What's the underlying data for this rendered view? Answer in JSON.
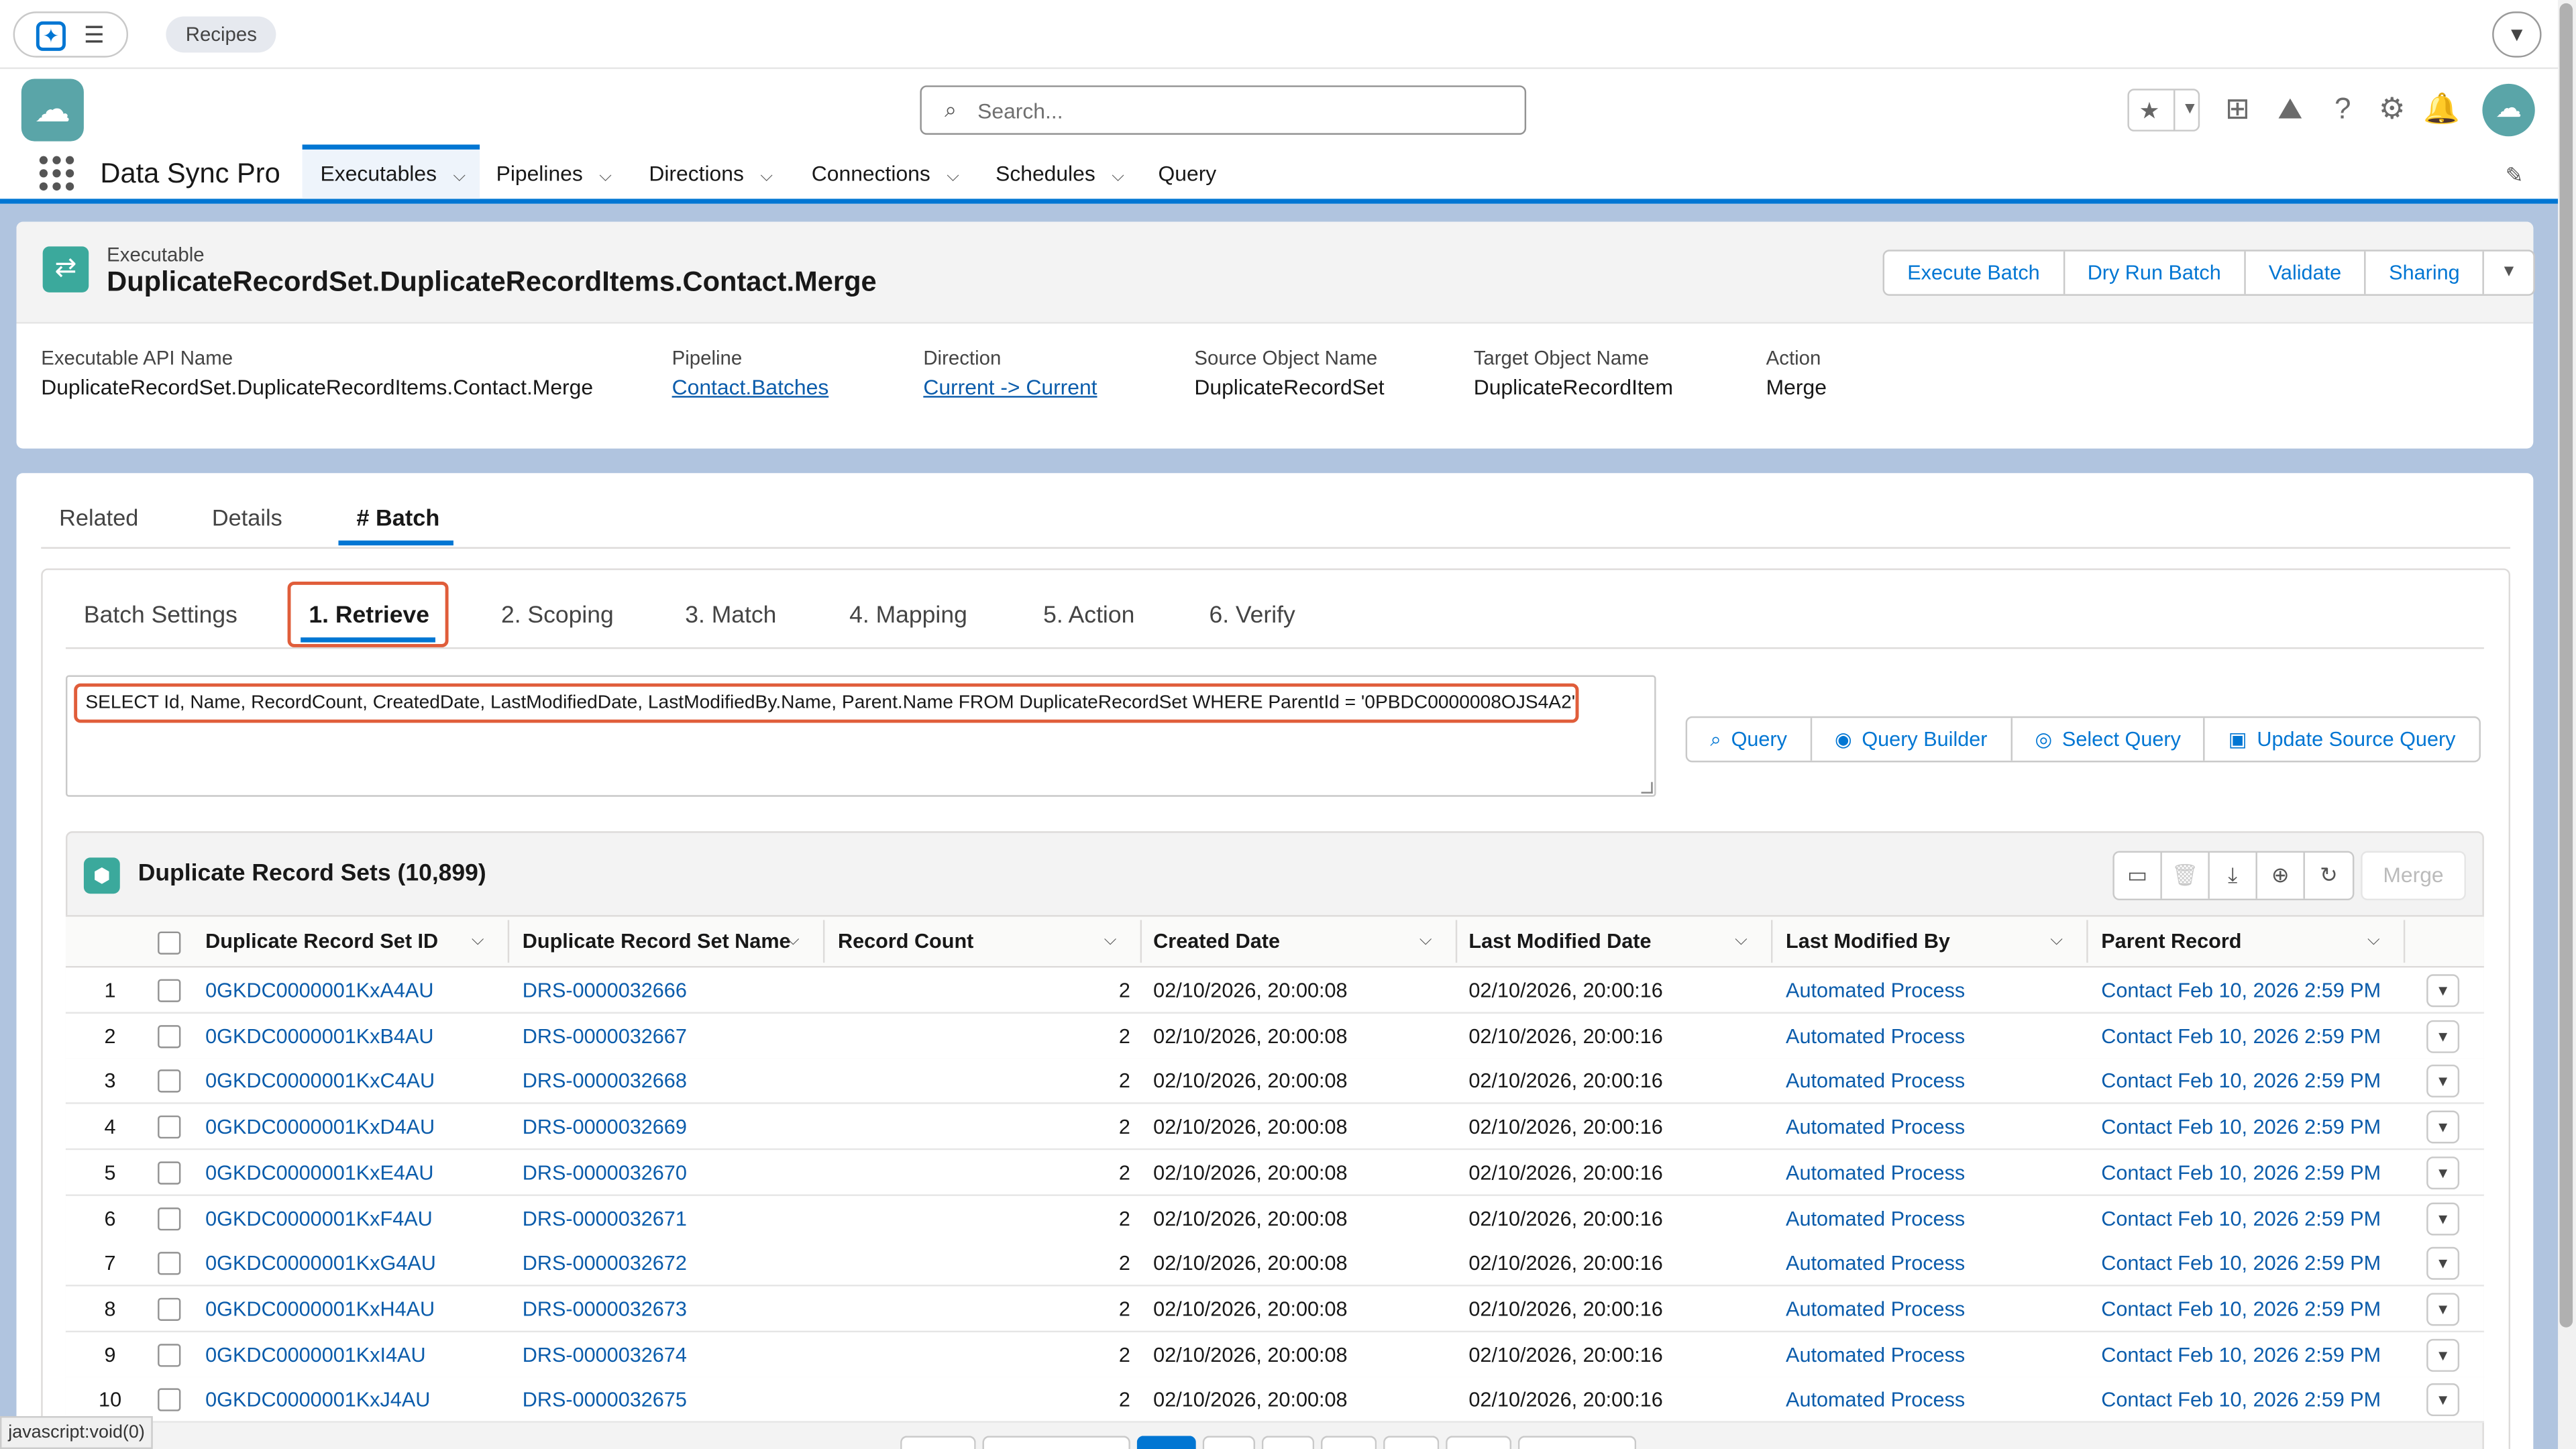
{
  "browser": {
    "tab_pill": "Recipes"
  },
  "header": {
    "search_placeholder": "Search...",
    "accent_color": "#0176d3"
  },
  "nav": {
    "app_name": "Data Sync Pro",
    "items": [
      {
        "label": "Executables",
        "active": true,
        "has_menu": true
      },
      {
        "label": "Pipelines",
        "has_menu": true
      },
      {
        "label": "Directions",
        "has_menu": true
      },
      {
        "label": "Connections",
        "has_menu": true
      },
      {
        "label": "Schedules",
        "has_menu": true
      },
      {
        "label": "Query",
        "has_menu": false
      }
    ]
  },
  "record": {
    "type_label": "Executable",
    "title": "DuplicateRecordSet.DuplicateRecordItems.Contact.Merge",
    "actions": [
      "Execute Batch",
      "Dry Run Batch",
      "Validate",
      "Sharing"
    ],
    "fields": [
      {
        "label": "Executable API Name",
        "value": "DuplicateRecordSet.DuplicateRecordItems.Contact.Merge",
        "link": false
      },
      {
        "label": "Pipeline",
        "value": "Contact.Batches",
        "link": true
      },
      {
        "label": "Direction",
        "value": "Current -> Current",
        "link": true
      },
      {
        "label": "Source Object Name",
        "value": "DuplicateRecordSet",
        "link": false
      },
      {
        "label": "Target Object Name",
        "value": "DuplicateRecordItem",
        "link": false
      },
      {
        "label": "Action",
        "value": "Merge",
        "link": false
      }
    ]
  },
  "main_tabs": [
    {
      "label": "Related"
    },
    {
      "label": "Details"
    },
    {
      "label": "# Batch",
      "active": true
    }
  ],
  "batch_tabs": [
    {
      "label": "Batch Settings"
    },
    {
      "label": "1. Retrieve",
      "active": true
    },
    {
      "label": "2. Scoping"
    },
    {
      "label": "3. Match"
    },
    {
      "label": "4. Mapping"
    },
    {
      "label": "5. Action"
    },
    {
      "label": "6. Verify"
    }
  ],
  "query": {
    "text": "SELECT Id, Name, RecordCount, CreatedDate, LastModifiedDate, LastModifiedBy.Name, Parent.Name FROM DuplicateRecordSet WHERE ParentId = '0PBDC0000008OJS4A2'",
    "buttons": [
      {
        "label": "Query",
        "icon": "search-icon"
      },
      {
        "label": "Query Builder",
        "icon": "eye-icon"
      },
      {
        "label": "Select Query",
        "icon": "target-icon"
      },
      {
        "label": "Update Source Query",
        "icon": "save-icon"
      }
    ]
  },
  "related_list": {
    "title": "Duplicate Record Sets (10,899)",
    "tool_icons": [
      "save-icon",
      "delete-icon",
      "download-icon",
      "add-icon",
      "refresh-icon"
    ],
    "merge_label": "Merge",
    "columns": [
      "Duplicate Record Set ID",
      "Duplicate Record Set Name",
      "Record Count",
      "Created Date",
      "Last Modified Date",
      "Last Modified By",
      "Parent Record"
    ],
    "rows": [
      {
        "n": "1",
        "id": "0GKDC0000001KxA4AU",
        "name": "DRS-0000032666",
        "count": "2",
        "created": "02/10/2026, 20:00:08",
        "modified": "02/10/2026, 20:00:16",
        "by": "Automated Process",
        "parent": "Contact Feb 10, 2026 2:59 PM"
      },
      {
        "n": "2",
        "id": "0GKDC0000001KxB4AU",
        "name": "DRS-0000032667",
        "count": "2",
        "created": "02/10/2026, 20:00:08",
        "modified": "02/10/2026, 20:00:16",
        "by": "Automated Process",
        "parent": "Contact Feb 10, 2026 2:59 PM"
      },
      {
        "n": "3",
        "id": "0GKDC0000001KxC4AU",
        "name": "DRS-0000032668",
        "count": "2",
        "created": "02/10/2026, 20:00:08",
        "modified": "02/10/2026, 20:00:16",
        "by": "Automated Process",
        "parent": "Contact Feb 10, 2026 2:59 PM"
      },
      {
        "n": "4",
        "id": "0GKDC0000001KxD4AU",
        "name": "DRS-0000032669",
        "count": "2",
        "created": "02/10/2026, 20:00:08",
        "modified": "02/10/2026, 20:00:16",
        "by": "Automated Process",
        "parent": "Contact Feb 10, 2026 2:59 PM"
      },
      {
        "n": "5",
        "id": "0GKDC0000001KxE4AU",
        "name": "DRS-0000032670",
        "count": "2",
        "created": "02/10/2026, 20:00:08",
        "modified": "02/10/2026, 20:00:16",
        "by": "Automated Process",
        "parent": "Contact Feb 10, 2026 2:59 PM"
      },
      {
        "n": "6",
        "id": "0GKDC0000001KxF4AU",
        "name": "DRS-0000032671",
        "count": "2",
        "created": "02/10/2026, 20:00:08",
        "modified": "02/10/2026, 20:00:16",
        "by": "Automated Process",
        "parent": "Contact Feb 10, 2026 2:59 PM"
      },
      {
        "n": "7",
        "id": "0GKDC0000001KxG4AU",
        "name": "DRS-0000032672",
        "count": "2",
        "created": "02/10/2026, 20:00:08",
        "modified": "02/10/2026, 20:00:16",
        "by": "Automated Process",
        "parent": "Contact Feb 10, 2026 2:59 PM"
      },
      {
        "n": "8",
        "id": "0GKDC0000001KxH4AU",
        "name": "DRS-0000032673",
        "count": "2",
        "created": "02/10/2026, 20:00:08",
        "modified": "02/10/2026, 20:00:16",
        "by": "Automated Process",
        "parent": "Contact Feb 10, 2026 2:59 PM"
      },
      {
        "n": "9",
        "id": "0GKDC0000001KxI4AU",
        "name": "DRS-0000032674",
        "count": "2",
        "created": "02/10/2026, 20:00:08",
        "modified": "02/10/2026, 20:00:16",
        "by": "Automated Process",
        "parent": "Contact Feb 10, 2026 2:59 PM"
      },
      {
        "n": "10",
        "id": "0GKDC0000001KxJ4AU",
        "name": "DRS-0000032675",
        "count": "2",
        "created": "02/10/2026, 20:00:08",
        "modified": "02/10/2026, 20:00:16",
        "by": "Automated Process",
        "parent": "Contact Feb 10, 2026 2:59 PM"
      }
    ]
  },
  "status_bar": "javascript:void(0)"
}
